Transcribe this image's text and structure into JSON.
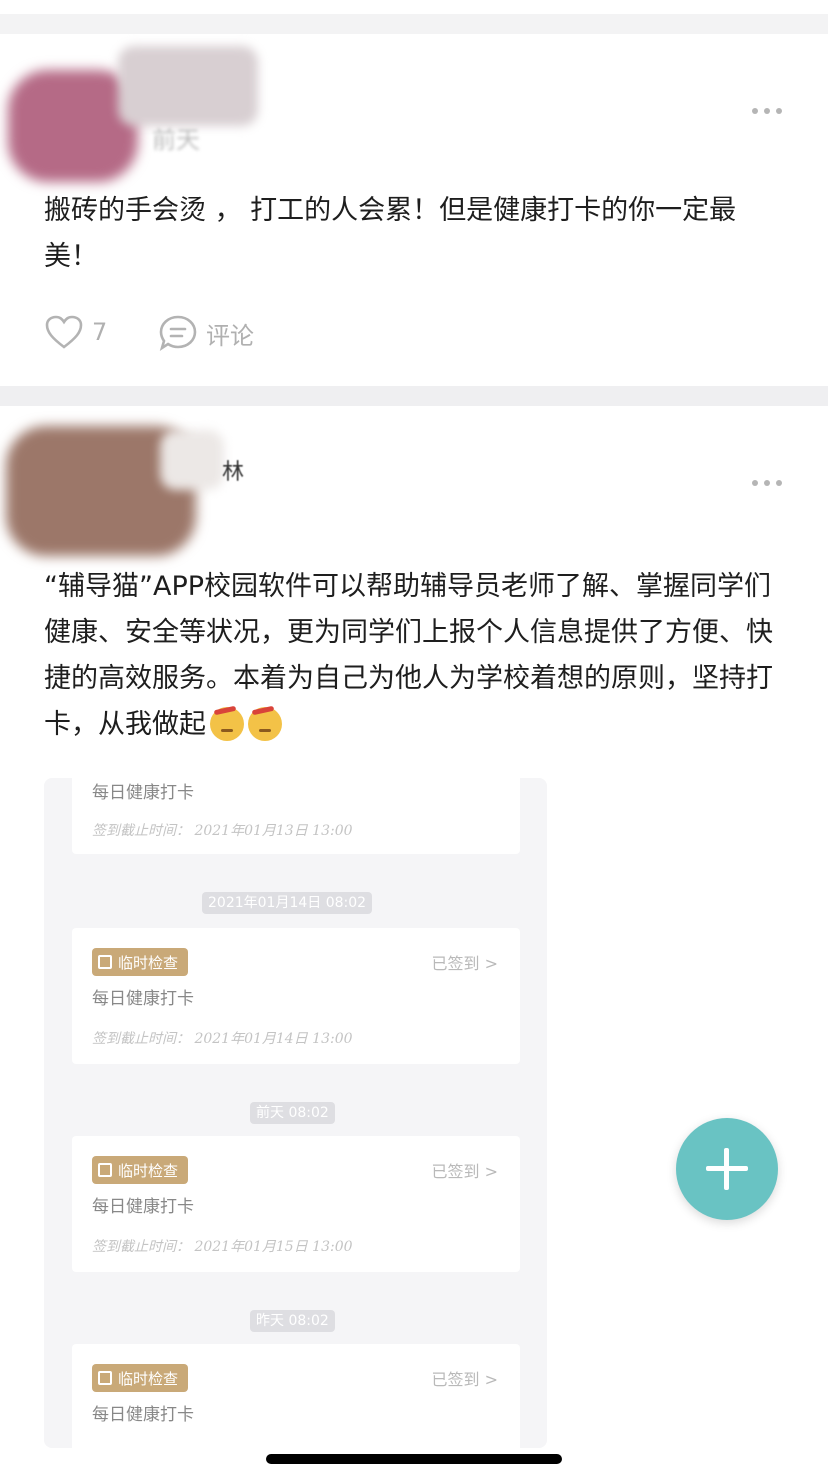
{
  "posts": [
    {
      "time": "前天",
      "text": "搬砖的手会烫 ， 打工的人会累！但是健康打卡的你一定最美！",
      "likes": "7",
      "comment_label": "评论"
    },
    {
      "name_fragment": "林",
      "text": "“辅导猫”APP校园软件可以帮助辅导员老师了解、掌握同学们健康、安全等状况，更为同学们上报个人信息提供了方便、快捷的高效服务。本着为自己为他人为学校着想的原则，坚持打卡，从我做起",
      "screenshot": {
        "cards": [
          {
            "title": "每日健康打卡",
            "deadline": "签到截止时间：  2021年01月13日 13:00"
          },
          {
            "badge": "临时检查",
            "status": "已签到 >",
            "title": "每日健康打卡",
            "deadline": "签到截止时间：  2021年01月14日 13:00"
          },
          {
            "badge": "临时检查",
            "status": "已签到 >",
            "title": "每日健康打卡",
            "deadline": "签到截止时间：  2021年01月15日 13:00"
          },
          {
            "badge": "临时检查",
            "status": "已签到 >",
            "title": "每日健康打卡"
          }
        ],
        "date_labels": [
          "2021年01月14日 08:02",
          "前天 08:02",
          "昨天 08:02"
        ]
      }
    }
  ],
  "colors": {
    "accent_fab": "#69c3c3",
    "badge": "#c9a978"
  },
  "icons": [
    "more-icon",
    "heart-icon",
    "comment-icon",
    "calendar-icon",
    "plus-icon",
    "emoji-icon"
  ]
}
